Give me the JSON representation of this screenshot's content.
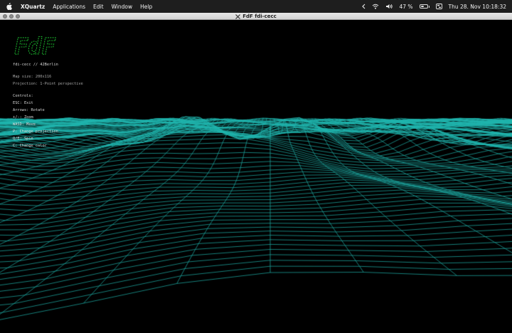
{
  "menubar": {
    "app_name": "XQuartz",
    "items": [
      "Applications",
      "Edit",
      "Window",
      "Help"
    ],
    "battery_percent": "47 %",
    "battery_level": 0.47,
    "datetime": "Thu 28. Nov  10:18:32"
  },
  "window": {
    "title": "FdF fdi-cecc"
  },
  "logo": {
    "text": "FdF"
  },
  "hud": {
    "header": "fdi-cecc // 42Berlin",
    "map_size": "Map size: 200x116",
    "projection": "Projection: 1-Point perspective",
    "controls_title": "Controls:",
    "controls": [
      "ESC: Exit",
      "Arrows: Rotate",
      "+/-: Zoom",
      "WASD: Move",
      "P: Change projection",
      "Q/E: Spin",
      "C: Change color"
    ]
  },
  "colors": {
    "wire": "#1fb5ad",
    "logo_green": "#19a82a",
    "menubar_bg": "#1e1e1e",
    "titlebar_bg": "#dcdcdc"
  },
  "icons": [
    "apple-icon",
    "chevron-left-icon",
    "wifi-icon",
    "speaker-icon",
    "battery-icon",
    "control-center-icon",
    "xquartz-icon"
  ]
}
